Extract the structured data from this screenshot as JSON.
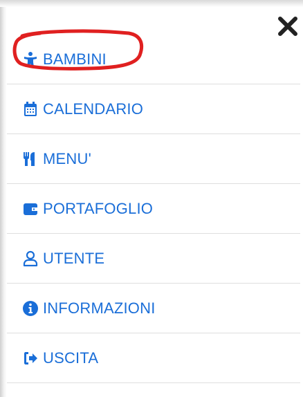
{
  "menu": {
    "close_icon": "close-icon",
    "items": [
      {
        "label": "BAMBINI",
        "icon": "child-icon"
      },
      {
        "label": "CALENDARIO",
        "icon": "calendar-icon"
      },
      {
        "label": "MENU'",
        "icon": "utensils-icon"
      },
      {
        "label": "PORTAFOGLIO",
        "icon": "wallet-icon"
      },
      {
        "label": "UTENTE",
        "icon": "user-icon"
      },
      {
        "label": "INFORMAZIONI",
        "icon": "info-icon"
      },
      {
        "label": "USCITA",
        "icon": "sign-out-icon"
      }
    ]
  },
  "colors": {
    "accent": "#1a6ed8",
    "highlight_circle": "#e02020",
    "close": "#222222",
    "divider": "#dedede"
  }
}
